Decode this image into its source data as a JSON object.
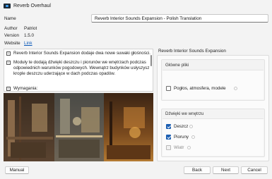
{
  "window": {
    "title": "Reverb Overhaul"
  },
  "fields": {
    "name_label": "Name",
    "name_value": "Reverb Interior Sounds Expansion - Polish Translation",
    "author_label": "Author",
    "author_value": "Patriot",
    "version_label": "Version",
    "version_value": "1.5.0",
    "website_label": "Website",
    "website_link": "Link"
  },
  "description": {
    "line1": "Reverb Interior Sounds Expansion dodaje dwa nowe suwaki głośności.",
    "line2": "Moduły te dodają dźwięki deszczu i piorunów we wnętrzach podczas",
    "line3": "odpowiednich warunków pogodowych. Wewnątrz budynków usłyszysz",
    "line4": "krople deszczu uderzające w dach podczas opadów.",
    "line5": "Wymagania:"
  },
  "panel": {
    "title": "Reverb Interior Sounds Expansion",
    "group1": {
      "title": "Główne pliki",
      "items": [
        {
          "label": "Pogłos, atmosfera, modele",
          "checked": false,
          "disabled": false
        }
      ]
    },
    "group2": {
      "title": "Dźwięki we wnętrzu",
      "items": [
        {
          "label": "Deszcz",
          "checked": true,
          "disabled": false
        },
        {
          "label": "Pioruny",
          "checked": true,
          "disabled": false
        },
        {
          "label": "Wiatr",
          "checked": false,
          "disabled": true
        }
      ]
    }
  },
  "buttons": {
    "manual": "Manual",
    "back": "Back",
    "next": "Next",
    "cancel": "Cancel"
  },
  "colors": {
    "accent": "#1c5fb2",
    "link": "#0a58b8"
  }
}
